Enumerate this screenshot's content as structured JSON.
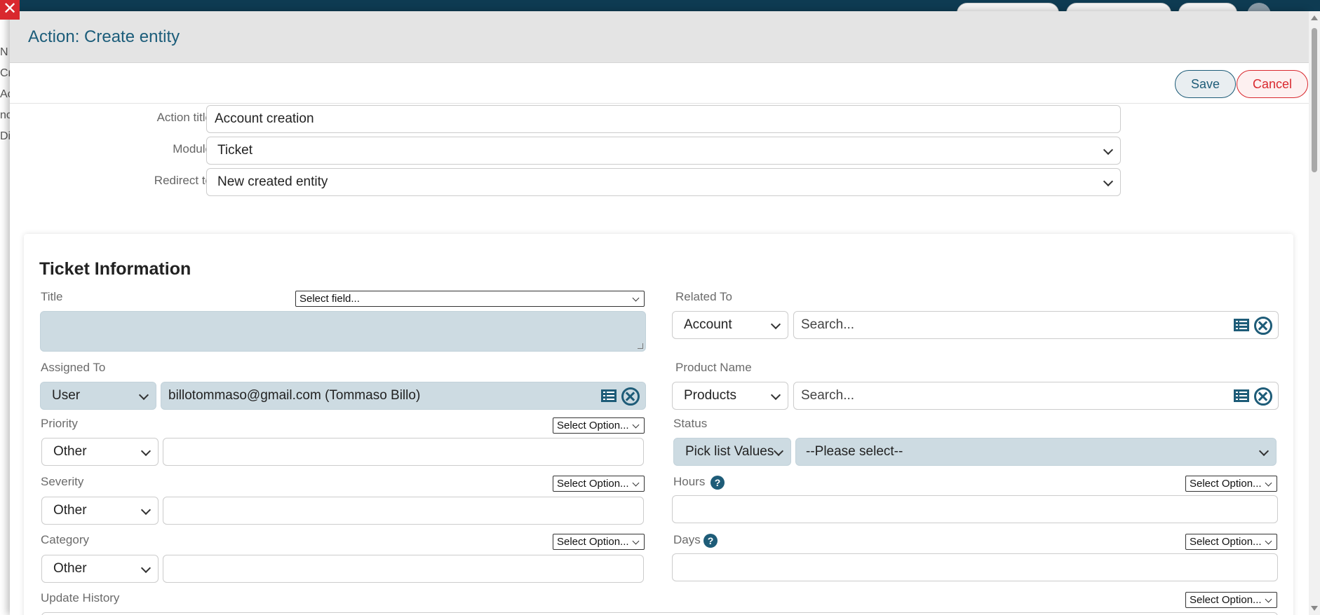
{
  "background": {
    "close_glyph": "✕",
    "side_fragments": [
      "N",
      "Cr",
      "Ac",
      "nc",
      "Di"
    ]
  },
  "modal": {
    "title": "Action: Create entity",
    "save_label": "Save",
    "cancel_label": "Cancel",
    "fields": {
      "action_title": {
        "label": "Action title",
        "value": "Account creation"
      },
      "module": {
        "label": "Module",
        "value": "Ticket"
      },
      "redirect_to": {
        "label": "Redirect to",
        "value": "New created entity"
      }
    }
  },
  "card": {
    "title": "Ticket Information",
    "title_field": {
      "label": "Title",
      "select": "Select field...",
      "value": ""
    },
    "related_to": {
      "label": "Related To",
      "type": "Account",
      "search_placeholder": "Search..."
    },
    "assigned_to": {
      "label": "Assigned To",
      "type": "User",
      "value": "billotommaso@gmail.com (Tommaso Billo)"
    },
    "product_name": {
      "label": "Product Name",
      "type": "Products",
      "search_placeholder": "Search..."
    },
    "priority": {
      "label": "Priority",
      "select": "Select Option...",
      "type": "Other",
      "value": ""
    },
    "status": {
      "label": "Status",
      "type": "Pick list Values",
      "value": "--Please select--"
    },
    "severity": {
      "label": "Severity",
      "select": "Select Option...",
      "type": "Other",
      "value": ""
    },
    "hours": {
      "label": "Hours",
      "select": "Select Option...",
      "value": ""
    },
    "category": {
      "label": "Category",
      "select": "Select Option...",
      "type": "Other",
      "value": ""
    },
    "days": {
      "label": "Days",
      "select": "Select Option...",
      "value": ""
    },
    "update_history": {
      "label": "Update History",
      "select": "Select Option..."
    }
  },
  "colors": {
    "accent": "#1e5c78",
    "danger": "#d9282e",
    "field_blue": "#cddbe2",
    "header_bg": "#e4e4e4"
  }
}
